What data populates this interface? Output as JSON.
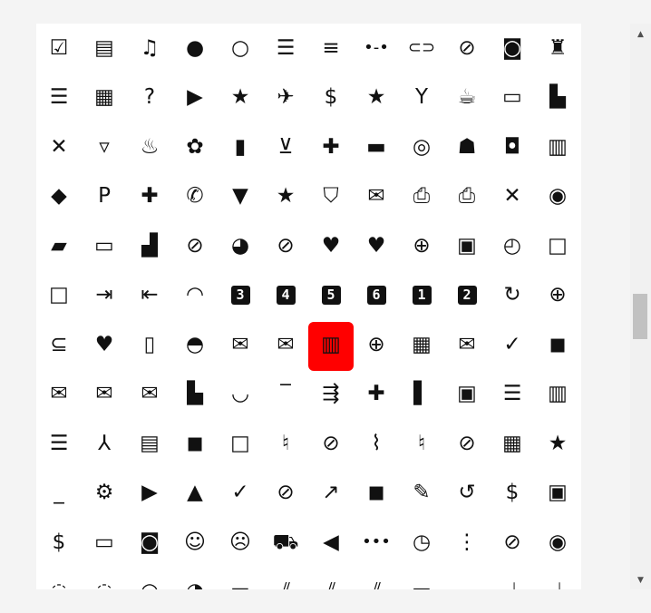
{
  "theme": {
    "accent": "#ff0000",
    "icon_color": "#111111",
    "panel_bg": "#ffffff",
    "page_bg": "#f4f4f4"
  },
  "selected_icon": "map-icon",
  "scrollbar": {
    "up_arrow": "▲",
    "down_arrow": "▼",
    "scroll_position": 0.52
  },
  "icons": [
    {
      "name": "library-add-check-icon",
      "glyph": "☑"
    },
    {
      "name": "library-books-icon",
      "glyph": "▤"
    },
    {
      "name": "library-music-icon",
      "glyph": "♫"
    },
    {
      "name": "lightbulb-icon",
      "glyph": "●"
    },
    {
      "name": "lightbulb-outline-icon",
      "glyph": "○"
    },
    {
      "name": "line-style-icon",
      "glyph": "☰"
    },
    {
      "name": "line-weight-icon",
      "glyph": "≡"
    },
    {
      "name": "linear-scale-icon",
      "glyph": "•-•"
    },
    {
      "name": "link-icon",
      "glyph": "⊂⊃"
    },
    {
      "name": "link-off-icon",
      "glyph": "⊘"
    },
    {
      "name": "linked-camera-icon",
      "glyph": "◙"
    },
    {
      "name": "liquor-icon",
      "glyph": "♜"
    },
    {
      "name": "list-icon",
      "glyph": "☰"
    },
    {
      "name": "list-alt-icon",
      "glyph": "▦"
    },
    {
      "name": "live-help-icon",
      "glyph": "?"
    },
    {
      "name": "live-tv-icon",
      "glyph": "▶"
    },
    {
      "name": "local-activity-icon",
      "glyph": "★"
    },
    {
      "name": "local-airport-icon",
      "glyph": "✈"
    },
    {
      "name": "local-atm-icon",
      "glyph": "$"
    },
    {
      "name": "local-attraction-icon",
      "glyph": "★"
    },
    {
      "name": "local-bar-icon",
      "glyph": "Y"
    },
    {
      "name": "local-cafe-icon",
      "glyph": "☕"
    },
    {
      "name": "local-car-wash-icon",
      "glyph": "▭"
    },
    {
      "name": "local-convenience-store-icon",
      "glyph": "▙"
    },
    {
      "name": "local-dining-icon",
      "glyph": "✕"
    },
    {
      "name": "local-drink-icon",
      "glyph": "▿"
    },
    {
      "name": "local-fire-department-icon",
      "glyph": "♨"
    },
    {
      "name": "local-florist-icon",
      "glyph": "✿"
    },
    {
      "name": "local-gas-station-icon",
      "glyph": "▮"
    },
    {
      "name": "local-grocery-store-icon",
      "glyph": "⊻"
    },
    {
      "name": "local-hospital-icon",
      "glyph": "✚"
    },
    {
      "name": "local-hotel-icon",
      "glyph": "▬"
    },
    {
      "name": "local-laundry-service-icon",
      "glyph": "◎"
    },
    {
      "name": "local-library-icon",
      "glyph": "☗"
    },
    {
      "name": "local-mall-icon",
      "glyph": "◘"
    },
    {
      "name": "local-movies-icon",
      "glyph": "▥"
    },
    {
      "name": "local-offer-icon",
      "glyph": "◆"
    },
    {
      "name": "local-parking-icon",
      "glyph": "P"
    },
    {
      "name": "local-pharmacy-icon",
      "glyph": "✚"
    },
    {
      "name": "local-phone-icon",
      "glyph": "✆"
    },
    {
      "name": "local-pizza-icon",
      "glyph": "▼"
    },
    {
      "name": "local-play-icon",
      "glyph": "★"
    },
    {
      "name": "local-police-icon",
      "glyph": "⛉"
    },
    {
      "name": "local-post-office-icon",
      "glyph": "✉"
    },
    {
      "name": "local-print-shop-icon",
      "glyph": "⎙"
    },
    {
      "name": "local-printshop-icon",
      "glyph": "⎙"
    },
    {
      "name": "local-restaurant-icon",
      "glyph": "✕"
    },
    {
      "name": "local-see-icon",
      "glyph": "◉"
    },
    {
      "name": "local-shipping-icon",
      "glyph": "▰"
    },
    {
      "name": "local-taxi-icon",
      "glyph": "▭"
    },
    {
      "name": "location-city-icon",
      "glyph": "▟"
    },
    {
      "name": "location-disabled-icon",
      "glyph": "⊘"
    },
    {
      "name": "location-history-icon",
      "glyph": "◕"
    },
    {
      "name": "location-off-icon",
      "glyph": "⊘"
    },
    {
      "name": "location-on-icon",
      "glyph": "♥"
    },
    {
      "name": "location-pin-icon",
      "glyph": "♥"
    },
    {
      "name": "location-searching-icon",
      "glyph": "⊕"
    },
    {
      "name": "lock-icon",
      "glyph": "▣"
    },
    {
      "name": "lock-clock-icon",
      "glyph": "◴"
    },
    {
      "name": "lock-open-icon",
      "glyph": "□"
    },
    {
      "name": "lock-outline-icon",
      "glyph": "□"
    },
    {
      "name": "login-icon",
      "glyph": "⇥"
    },
    {
      "name": "logout-icon",
      "glyph": "⇤"
    },
    {
      "name": "looks-icon",
      "glyph": "◠"
    },
    {
      "name": "looks-3-icon",
      "glyph": "3",
      "box": true
    },
    {
      "name": "looks-4-icon",
      "glyph": "4",
      "box": true
    },
    {
      "name": "looks-5-icon",
      "glyph": "5",
      "box": true
    },
    {
      "name": "looks-6-icon",
      "glyph": "6",
      "box": true
    },
    {
      "name": "looks-one-icon",
      "glyph": "1",
      "box": true
    },
    {
      "name": "looks-two-icon",
      "glyph": "2",
      "box": true
    },
    {
      "name": "loop-icon",
      "glyph": "↻"
    },
    {
      "name": "loupe-icon",
      "glyph": "⊕"
    },
    {
      "name": "low-priority-icon",
      "glyph": "⊆"
    },
    {
      "name": "loyalty-icon",
      "glyph": "♥"
    },
    {
      "name": "luggage-icon",
      "glyph": "▯"
    },
    {
      "name": "lunch-dining-icon",
      "glyph": "◓"
    },
    {
      "name": "mail-icon",
      "glyph": "✉"
    },
    {
      "name": "mail-outline-icon",
      "glyph": "✉"
    },
    {
      "name": "map-icon",
      "glyph": "▥",
      "active": true
    },
    {
      "name": "maps-ugc-icon",
      "glyph": "⊕"
    },
    {
      "name": "margin-icon",
      "glyph": "▦"
    },
    {
      "name": "mark-as-unread-icon",
      "glyph": "✉"
    },
    {
      "name": "mark-chat-read-icon",
      "glyph": "✓"
    },
    {
      "name": "mark-chat-unread-icon",
      "glyph": "◼"
    },
    {
      "name": "mark-email-read-icon",
      "glyph": "✉"
    },
    {
      "name": "mark-email-unread-icon",
      "glyph": "✉"
    },
    {
      "name": "markunread-icon",
      "glyph": "✉"
    },
    {
      "name": "markunread-mailbox-icon",
      "glyph": "▙"
    },
    {
      "name": "masks-icon",
      "glyph": "◡"
    },
    {
      "name": "maximize-icon",
      "glyph": "‾"
    },
    {
      "name": "merge-type-icon",
      "glyph": "⇶"
    },
    {
      "name": "medical-services-icon",
      "glyph": "✚"
    },
    {
      "name": "meeting-room-icon",
      "glyph": "▌"
    },
    {
      "name": "memory-icon",
      "glyph": "▣"
    },
    {
      "name": "menu-icon",
      "glyph": "☰"
    },
    {
      "name": "menu-book-icon",
      "glyph": "▥"
    },
    {
      "name": "menu-open-icon",
      "glyph": "☰"
    },
    {
      "name": "merge-icon",
      "glyph": "⅄"
    },
    {
      "name": "message-icon",
      "glyph": "▤"
    },
    {
      "name": "chat-bubble-icon",
      "glyph": "◼"
    },
    {
      "name": "chat-bubble-outline-icon",
      "glyph": "□"
    },
    {
      "name": "mic-icon",
      "glyph": "♮"
    },
    {
      "name": "mic-external-off-icon",
      "glyph": "⊘"
    },
    {
      "name": "mic-external-on-icon",
      "glyph": "⌇"
    },
    {
      "name": "mic-none-icon",
      "glyph": "♮"
    },
    {
      "name": "mic-off-icon",
      "glyph": "⊘"
    },
    {
      "name": "microwave-icon",
      "glyph": "▦"
    },
    {
      "name": "military-tech-icon",
      "glyph": "★"
    },
    {
      "name": "minimize-icon",
      "glyph": "_"
    },
    {
      "name": "miscellaneous-services-icon",
      "glyph": "⚙"
    },
    {
      "name": "missed-video-call-icon",
      "glyph": "▶"
    },
    {
      "name": "mms-icon",
      "glyph": "▲"
    },
    {
      "name": "mobile-friendly-icon",
      "glyph": "✓"
    },
    {
      "name": "mobile-off-icon",
      "glyph": "⊘"
    },
    {
      "name": "mobile-screen-share-icon",
      "glyph": "↗"
    },
    {
      "name": "mode-comment-icon",
      "glyph": "◼"
    },
    {
      "name": "mode-edit-icon",
      "glyph": "✎"
    },
    {
      "name": "model-training-icon",
      "glyph": "↺"
    },
    {
      "name": "monetization-on-icon",
      "glyph": "$"
    },
    {
      "name": "money-icon",
      "glyph": "▣"
    },
    {
      "name": "money-off-icon",
      "glyph": "$"
    },
    {
      "name": "monitor-icon",
      "glyph": "▭"
    },
    {
      "name": "monochrome-photos-icon",
      "glyph": "◙"
    },
    {
      "name": "mood-icon",
      "glyph": "☺"
    },
    {
      "name": "mood-bad-icon",
      "glyph": "☹"
    },
    {
      "name": "moped-icon",
      "glyph": "⛟"
    },
    {
      "name": "more-icon",
      "glyph": "◀"
    },
    {
      "name": "more-horiz-icon",
      "glyph": "•••"
    },
    {
      "name": "more-time-icon",
      "glyph": "◷"
    },
    {
      "name": "more-vert-icon",
      "glyph": "⋮"
    },
    {
      "name": "motion-photos-off-icon",
      "glyph": "⊘"
    },
    {
      "name": "motion-photos-on-icon",
      "glyph": "◉"
    },
    {
      "name": "motion-photos-pause-icon",
      "glyph": "◌"
    },
    {
      "name": "motion-photos-paused-icon",
      "glyph": "◌"
    },
    {
      "name": "mouse-icon",
      "glyph": "◠"
    },
    {
      "name": "move-to-inbox-icon",
      "glyph": "◕"
    },
    {
      "name": "movie-icon",
      "glyph": "▭"
    },
    {
      "name": "movie-creation-icon",
      "glyph": "⫽"
    },
    {
      "name": "movie-filter-icon",
      "glyph": "⫽"
    },
    {
      "name": "multiline-chart-icon",
      "glyph": "⫽"
    },
    {
      "name": "multiple-stop-icon",
      "glyph": "▬"
    },
    {
      "name": "museum-icon",
      "glyph": "◡"
    },
    {
      "name": "music-note-icon",
      "glyph": "♩"
    },
    {
      "name": "music-off-icon",
      "glyph": "♩"
    }
  ]
}
